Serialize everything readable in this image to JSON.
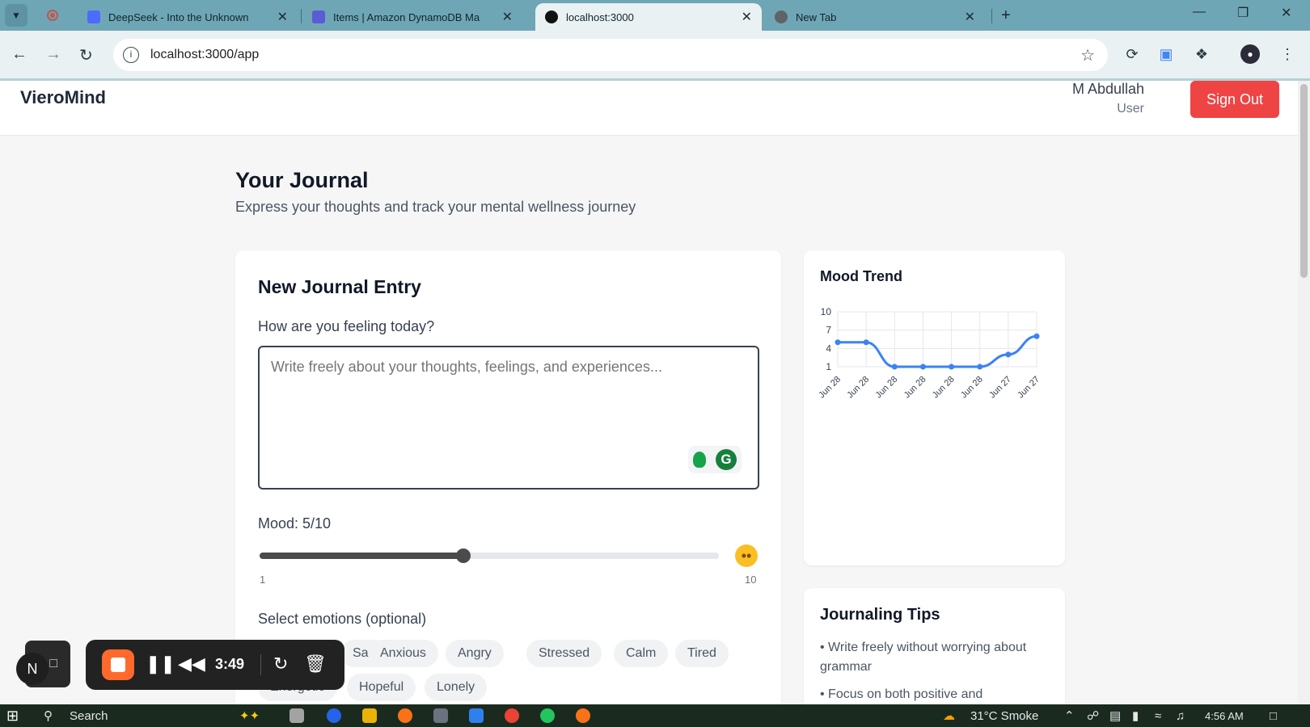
{
  "browser": {
    "tabs": [
      {
        "title": "DeepSeek - Into the Unknown",
        "favicon_color": "#4d6bfe"
      },
      {
        "title": "Items | Amazon DynamoDB Ma",
        "favicon_color": "#5b5bd6"
      },
      {
        "title": "localhost:3000",
        "favicon_color": "#111111",
        "active": true
      },
      {
        "title": "New Tab",
        "favicon_color": "#5f6368"
      }
    ],
    "url": "localhost:3000/app"
  },
  "app": {
    "logo": "VieroMind",
    "user": {
      "name": "M Abdullah",
      "role": "User"
    },
    "sign_out": "Sign Out"
  },
  "page": {
    "title": "Your Journal",
    "subtitle": "Express your thoughts and track your mental wellness journey"
  },
  "entry": {
    "title": "New Journal Entry",
    "feeling_label": "How are you feeling today?",
    "placeholder": "Write freely about your thoughts, feelings, and experiences...",
    "mood_label": "Mood: 5/10",
    "mood_value": 5,
    "mood_min": 1,
    "mood_max": 10,
    "scale_min_label": "1",
    "scale_max_label": "10",
    "emotions_label": "Select emotions (optional)",
    "emotions_row1": [
      "Sad",
      "Anxious",
      "Angry",
      "Stressed",
      "Calm",
      "Tired"
    ],
    "emotions_row2": [
      "Energetic",
      "Hopeful",
      "Lonely"
    ]
  },
  "mood_trend": {
    "title": "Mood Trend",
    "chart_data": {
      "type": "line",
      "x": [
        "Jun 28",
        "Jun 28",
        "Jun 28",
        "Jun 28",
        "Jun 28",
        "Jun 28",
        "Jun 27",
        "Jun 27"
      ],
      "values": [
        5,
        5,
        1,
        1,
        1,
        1,
        3,
        6
      ],
      "y_ticks": [
        "10",
        "7",
        "4",
        "1"
      ],
      "ylim": [
        1,
        10
      ],
      "grid": true,
      "line_color": "#3b82f6"
    }
  },
  "tips": {
    "title": "Journaling Tips",
    "items": [
      "• Write freely without worrying about grammar",
      "• Focus on both positive and"
    ]
  },
  "recorder": {
    "time": "3:49",
    "badge": "N"
  },
  "taskbar": {
    "search": "Search",
    "weather": "31°C  Smoke",
    "time": "4:56 AM"
  }
}
